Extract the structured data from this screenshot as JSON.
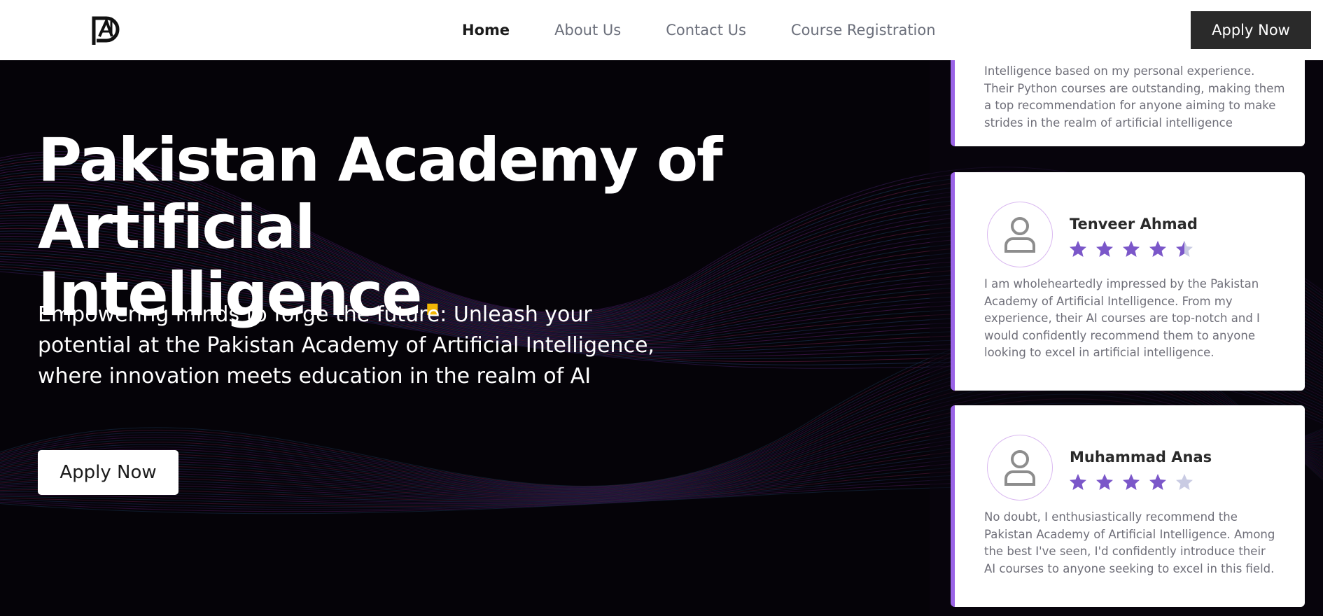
{
  "nav": {
    "links": [
      "Home",
      "About Us",
      "Contact Us",
      "Course Registration"
    ],
    "apply_label": "Apply Now"
  },
  "hero": {
    "title_line1": "Pakistan Academy of",
    "title_line2": "Artificial Intelligence",
    "title_dot": ".",
    "subtitle": "Empowering minds to forge the future: Unleash your potential at the Pakistan Academy of Artificial Intelligence, where innovation meets education in the realm of AI",
    "apply_label": "Apply Now"
  },
  "testimonials": [
    {
      "text": "Intelligence based on my personal experience. Their Python courses are outstanding, making them a top recommendation for anyone aiming to make strides in the realm of artificial intelligence"
    },
    {
      "name": "Tenveer Ahmad",
      "rating": 4.5,
      "text": "I am wholeheartedly impressed by the Pakistan Academy of Artificial Intelligence. From my experience, their AI courses are top-notch and I would confidently recommend them to anyone looking to excel in artificial intelligence."
    },
    {
      "name": "Muhammad Anas",
      "rating": 4,
      "text": "No doubt, I enthusiastically recommend the Pakistan Academy of Artificial Intelligence. Among the best I've seen, I'd confidently introduce their AI courses to anyone seeking to excel in this field."
    }
  ],
  "colors": {
    "accent_purple": "#9a63e6",
    "star_purple": "#7b57c9",
    "star_empty": "#c9cbe3",
    "title_dot": "#f2b705",
    "nav_button": "#2a2a2a"
  },
  "icons": {
    "logo": "pai-logo",
    "avatar": "user-icon",
    "star": "star-icon"
  }
}
